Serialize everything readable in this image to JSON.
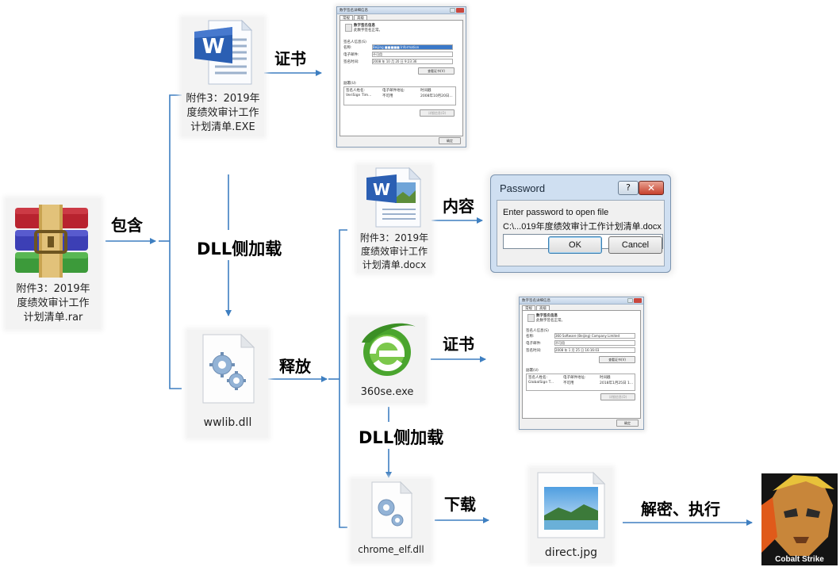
{
  "nodes": {
    "rar": {
      "label": "附件3：2019年\n度绩效审计工作\n计划清单.rar"
    },
    "exe": {
      "label": "附件3：2019年\n度绩效审计工作\n计划清单.EXE"
    },
    "dll": {
      "label": "wwlib.dll"
    },
    "docx": {
      "label": "附件3：2019年\n度绩效审计工作\n计划清单.docx"
    },
    "se360": {
      "label": "360se.exe"
    },
    "chrome": {
      "label": "chrome_elf.dll"
    },
    "jpg": {
      "label": "direct.jpg"
    },
    "cobalt": {
      "label": "Cobalt Strike"
    }
  },
  "edges": {
    "contains": "包含",
    "cert1": "证书",
    "sideload1": "DLL侧加载",
    "release": "释放",
    "content": "内容",
    "cert2": "证书",
    "sideload2": "DLL侧加载",
    "download": "下载",
    "decrypt": "解密、执行"
  },
  "cert_dialog1": {
    "title": "数字签名详细信息",
    "tabs": [
      "常规",
      "高级"
    ],
    "heading": "数字签名信息",
    "subheading": "此数字签名正常。",
    "signer_info": "签名人信息(S)",
    "name_label": "名称:",
    "name_value": "Beijing ■■■■■ Information",
    "email_label": "电子邮件:",
    "email_value": "不可用",
    "time_label": "签名时间:",
    "time_value": "2008 年 10 月 20 日 9:23:36",
    "view_cert": "查看证书(V)",
    "countersig": "副署(U)",
    "col1": "签名人姓名:",
    "col2": "电子邮件地址:",
    "col3": "时间戳",
    "row_name": "VeriSign Tim...",
    "row_email": "不可用",
    "row_time": "2008年10月20日...",
    "details": "详细信息(D)",
    "ok": "确定"
  },
  "cert_dialog2": {
    "title": "数字签名详细信息",
    "tabs": [
      "常规",
      "高级"
    ],
    "heading": "数字签名信息",
    "subheading": "此数字签名正常。",
    "signer_info": "签名人信息(S)",
    "name_label": "名称:",
    "name_value": "360 Software (Beijing) Company Limited",
    "email_label": "电子邮件:",
    "email_value": "不可用",
    "time_label": "签名时间:",
    "time_value": "2008 年 1 月 25 日 16:16:03",
    "view_cert": "查看证书(V)",
    "countersig": "副署(U)",
    "col1": "签名人姓名:",
    "col2": "电子邮件地址:",
    "col3": "时间戳",
    "row_name": "GlobalSign T...",
    "row_email": "不可用",
    "row_time": "2018年1月25日 1...",
    "details": "详细信息(D)",
    "ok": "确定"
  },
  "password_dialog": {
    "title": "Password",
    "help": "?",
    "close": "✕",
    "prompt": "Enter password to open file",
    "path": "C:\\...019年度绩效审计工作计划清单.docx",
    "ok": "OK",
    "cancel": "Cancel"
  },
  "colors": {
    "arrow": "#3e7fc1",
    "word_blue": "#2b5fb3",
    "ie_green": "#4aa52e"
  }
}
